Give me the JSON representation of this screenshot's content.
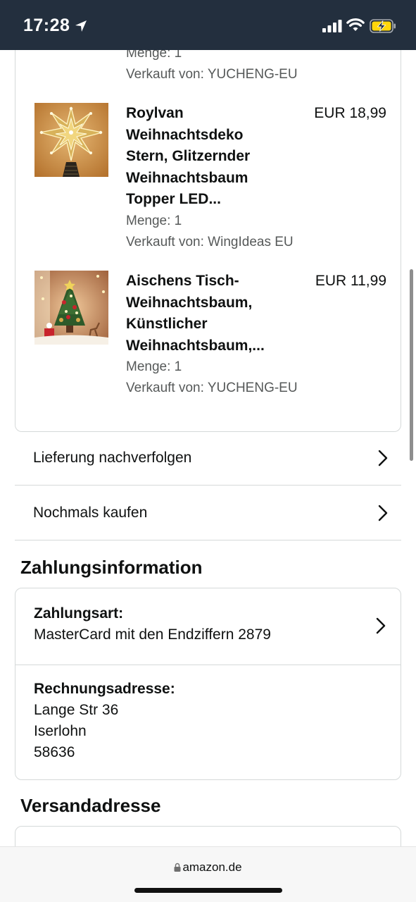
{
  "status_bar": {
    "time": "17:28",
    "icons": [
      "location-arrow-icon",
      "cellular-signal-icon",
      "wifi-icon",
      "battery-charging-icon"
    ]
  },
  "order_items": {
    "cut_item": {
      "quantity": "Menge: 1",
      "seller": "Verkauft von: YUCHENG-EU"
    },
    "items": [
      {
        "title": "Roylvan Weihnachtsdeko Stern, Glitzernder Weihnachtsbaum Topper LED...",
        "price": "EUR 18,99",
        "quantity": "Menge: 1",
        "seller": "Verkauft von: WingIdeas EU",
        "image": "gold-star-topper"
      },
      {
        "title": "Aischens Tisch-Weihnachtsbaum, Künstlicher Weihnachtsbaum,...",
        "price": "EUR 11,99",
        "quantity": "Menge: 1",
        "seller": "Verkauft von: YUCHENG-EU",
        "image": "mini-christmas-tree"
      }
    ]
  },
  "actions": {
    "track": "Lieferung nachverfolgen",
    "buy_again": "Nochmals kaufen"
  },
  "payment": {
    "section_title": "Zahlungsinformation",
    "method_label": "Zahlungsart:",
    "method_value": "MasterCard mit den Endziffern 2879",
    "billing_label": "Rechnungsadresse:",
    "billing_lines": [
      "Lange Str 36",
      "Iserlohn",
      "58636"
    ]
  },
  "shipping": {
    "section_title": "Versandadresse"
  },
  "browser": {
    "url": "amazon.de"
  },
  "colors": {
    "status_bar_bg": "#232f3e",
    "border": "#d5d9d9",
    "text": "#0f1111",
    "muted": "#565959"
  }
}
